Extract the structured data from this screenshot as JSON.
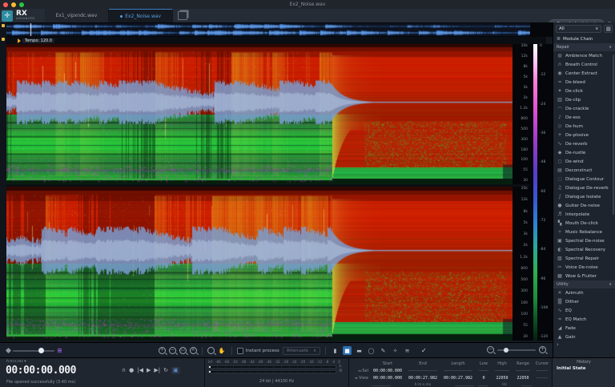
{
  "window": {
    "title": "Ex2_Noise.wav"
  },
  "header": {
    "logo": "RX",
    "logo_sub": "ADVANCED",
    "tabs": [
      {
        "label": "Ex1_vipxndc.wav",
        "active": false
      },
      {
        "label": "Ex2_Noise.wav",
        "active": true
      }
    ],
    "repair_assistant_label": "Repair Assistant"
  },
  "overview": {
    "tempo_marker": "Tempo: 120.0"
  },
  "module_panel": {
    "filter_value": "All",
    "module_chain_label": "Module Chain",
    "sections": [
      {
        "title": "Repair",
        "items": [
          "Ambience Match",
          "Breath Control",
          "Center Extract",
          "De-bleed",
          "De-click",
          "De-clip",
          "De-crackle",
          "De-ess",
          "De-hum",
          "De-plosive",
          "De-reverb",
          "De-rustle",
          "De-wind",
          "Deconstruct",
          "Dialogue Contour",
          "Dialogue De-reverb",
          "Dialogue Isolate",
          "Guitar De-noise",
          "Interpolate",
          "Mouth De-click",
          "Music Rebalance",
          "Spectral De-noise",
          "Spectral Recovery",
          "Spectral Repair",
          "Voice De-noise",
          "Wow & Flutter"
        ]
      },
      {
        "title": "Utility",
        "items": [
          "Azimuth",
          "Dither",
          "EQ",
          "EQ Match",
          "Fade",
          "Gain"
        ]
      }
    ]
  },
  "history_panel": {
    "title": "History",
    "items": [
      "Initial State"
    ]
  },
  "toolbar": {
    "instant_process_label": "Instant process",
    "process_mode_value": "Attenuate"
  },
  "transport": {
    "time_format": "h:m:s.ms",
    "time_display": "00:00:00.000"
  },
  "status_message": "File opened successfully (3.40 ms)",
  "meters": {
    "scale": [
      "Inf",
      "-66",
      "-60",
      "-54",
      "-48",
      "-44",
      "-40",
      "-36",
      "-32",
      "-28",
      "-24",
      "-20",
      "-16",
      "-12",
      "-8",
      "-4",
      "0"
    ],
    "file_format": "24 bit | 44100 Hz",
    "channels": [
      "L",
      "R"
    ]
  },
  "selection_info": {
    "columns": [
      "Start",
      "End",
      "Length",
      "Low",
      "High",
      "Range",
      "Cursor"
    ],
    "rows": [
      {
        "label": "Sel",
        "values": [
          "00:00:00.000",
          "",
          "",
          "",
          "",
          "",
          ""
        ]
      },
      {
        "label": "View",
        "values": [
          "00:00:00.000",
          "00:00:27.982",
          "00:00:27.982",
          "0",
          "22050",
          "22050",
          ""
        ]
      }
    ],
    "time_unit": "h:m:s.ms",
    "freq_unit": "Hz"
  },
  "spectrogram": {
    "freq_labels": [
      "20k",
      "12k",
      "8k",
      "5k",
      "3k",
      "2k",
      "1.2k",
      "800",
      "500",
      "300",
      "180",
      "100",
      "55",
      "30"
    ],
    "legend_db_labels": [
      "0",
      "-12",
      "-24",
      "-36",
      "-48",
      "-60",
      "-72",
      "-84",
      "-96",
      "-108",
      "-120"
    ],
    "colors": {
      "accent_blue": "#55a0e6",
      "legend_top": "#ffffff",
      "legend_bottom": "#051f0e"
    }
  }
}
